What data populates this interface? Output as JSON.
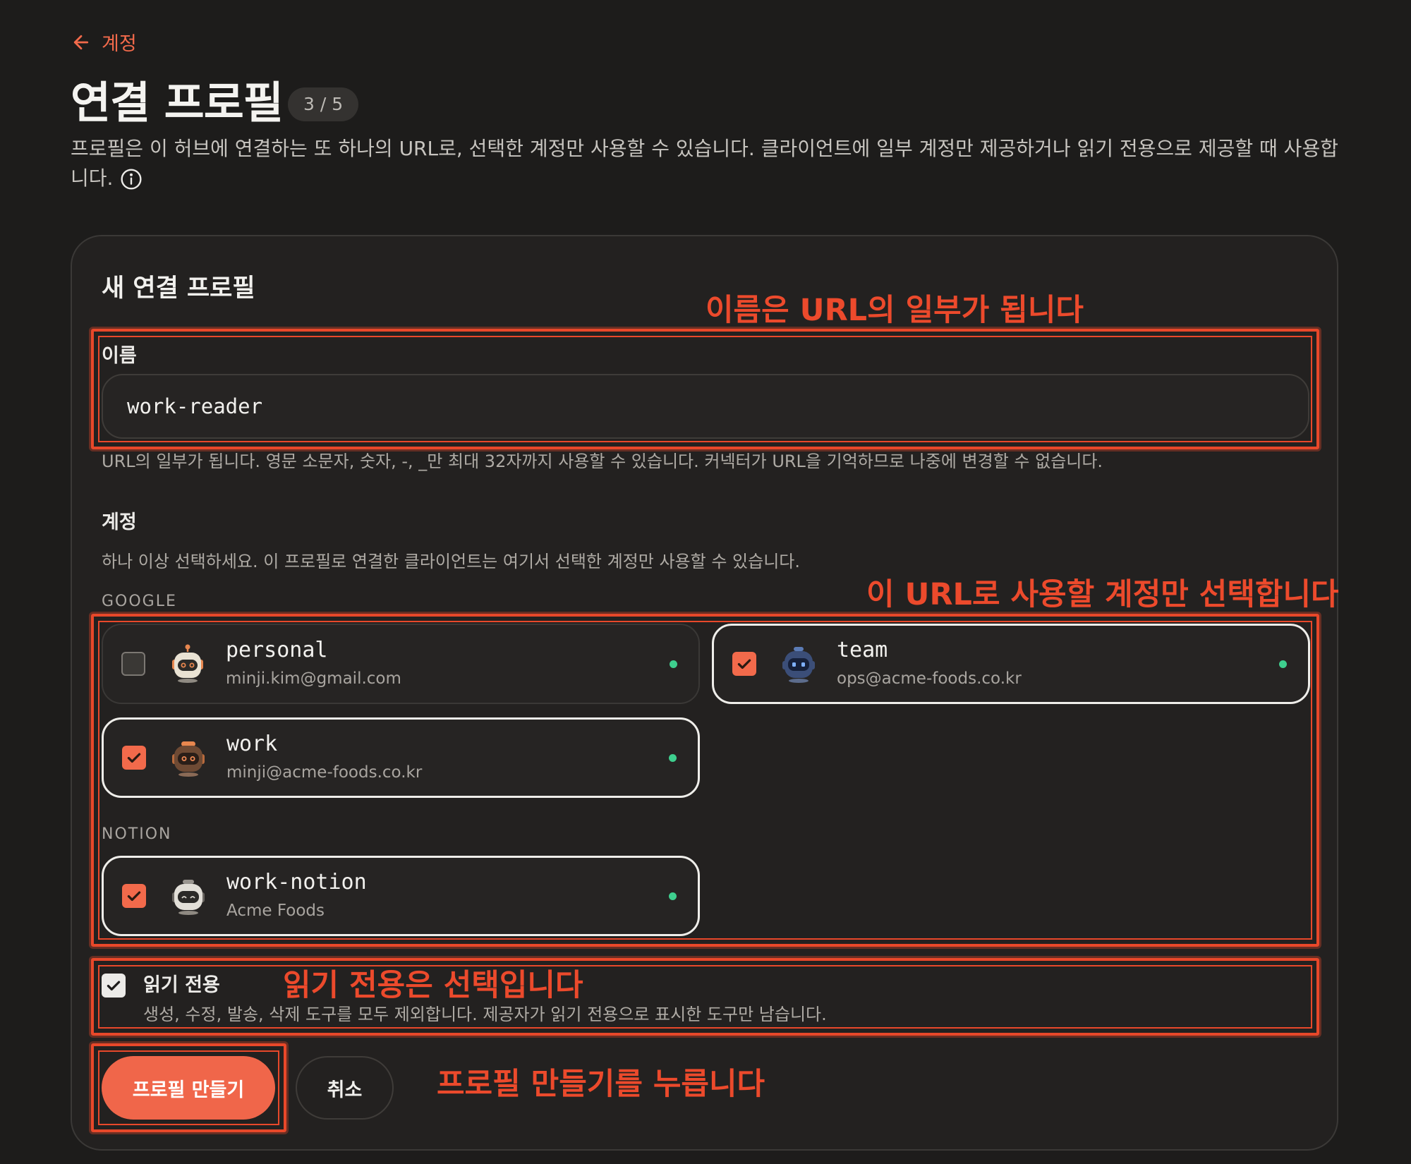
{
  "breadcrumb": {
    "back_label": "계정"
  },
  "header": {
    "title": "연결 프로필",
    "count_badge": "3 / 5",
    "description": "프로필은 이 허브에 연결하는 또 하나의 URL로, 선택한 계정만 사용할 수 있습니다. 클라이언트에 일부 계정만 제공하거나 읽기 전용으로 제공할 때 사용합니다."
  },
  "form": {
    "title": "새 연결 프로필",
    "name": {
      "label": "이름",
      "value": "work-reader",
      "help": "URL의 일부가 됩니다. 영문 소문자, 숫자, -, _만 최대 32자까지 사용할 수 있습니다. 커넥터가 URL을 기억하므로 나중에 변경할 수 없습니다."
    },
    "accounts": {
      "label": "계정",
      "help": "하나 이상 선택하세요. 이 프로필로 연결한 클라이언트는 여기서 선택한 계정만 사용할 수 있습니다.",
      "groups": [
        {
          "name": "GOOGLE",
          "items": [
            {
              "name": "personal",
              "sub": "minji.kim@gmail.com",
              "checked": false,
              "avatar_icon": "robot-avatar-icon",
              "status": "connected"
            },
            {
              "name": "team",
              "sub": "ops@acme-foods.co.kr",
              "checked": true,
              "avatar_icon": "robot-avatar-icon",
              "status": "connected"
            },
            {
              "name": "work",
              "sub": "minji@acme-foods.co.kr",
              "checked": true,
              "avatar_icon": "robot-avatar-icon",
              "status": "connected"
            }
          ]
        },
        {
          "name": "NOTION",
          "items": [
            {
              "name": "work-notion",
              "sub": "Acme Foods",
              "checked": true,
              "avatar_icon": "robot-avatar-icon",
              "status": "connected"
            }
          ]
        }
      ]
    },
    "read_only": {
      "label": "읽기 전용",
      "desc": "생성, 수정, 발송, 삭제 도구를 모두 제외합니다. 제공자가 읽기 전용으로 표시한 도구만 남습니다.",
      "checked": true
    },
    "buttons": {
      "create": "프로필 만들기",
      "cancel": "취소"
    }
  },
  "annotations": {
    "name": "이름은 URL의 일부가 됩니다",
    "accounts": "이 URL로 사용할 계정만 선택합니다",
    "read_only": "읽기 전용은 선택입니다",
    "create": "프로필 만들기를 누릅니다"
  },
  "colors": {
    "accent": "#f26a4b",
    "annotation": "#e8482a",
    "status_dot": "#3ecf8e",
    "background": "#1d1c1b"
  }
}
